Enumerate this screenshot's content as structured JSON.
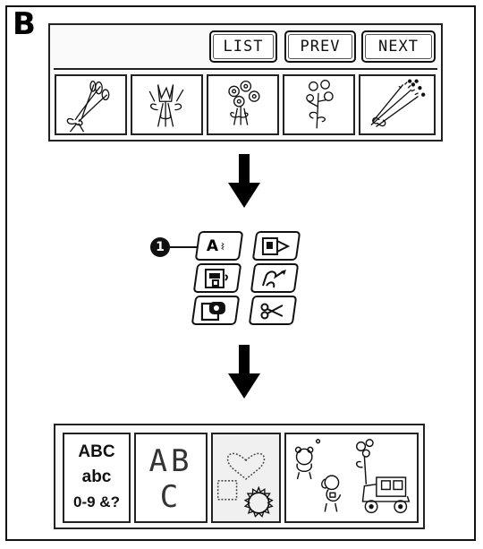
{
  "section_label": "B",
  "top_screen": {
    "buttons": {
      "list": "LIST",
      "prev": "PREV",
      "next": "NEXT"
    },
    "thumbnails": [
      {
        "icon": "bouquet-ribbon-icon"
      },
      {
        "icon": "tulip-bouquet-icon"
      },
      {
        "icon": "daisy-bouquet-icon"
      },
      {
        "icon": "flower-sprig-icon"
      },
      {
        "icon": "wheat-bouquet-icon"
      }
    ]
  },
  "mode_menu": {
    "callout": "1",
    "buttons": [
      {
        "icon": "character-mode-icon",
        "label": "A"
      },
      {
        "icon": "frame-pattern-icon"
      },
      {
        "icon": "memory-recall-icon"
      },
      {
        "icon": "edit-pattern-icon"
      },
      {
        "icon": "card-pattern-icon"
      },
      {
        "icon": "scissors-cut-icon"
      }
    ]
  },
  "bottom_screen": {
    "font_tile": {
      "line1": "ABC",
      "line2": "abc",
      "line3": "0-9 &?"
    },
    "large_letters_tile": {
      "line1": "AB",
      "line2": "C"
    },
    "tiles": [
      {
        "icon": "font-selection-icon"
      },
      {
        "icon": "large-letters-icon"
      },
      {
        "icon": "frame-shapes-icon"
      },
      {
        "icon": "pattern-illustrations-icon"
      }
    ]
  }
}
